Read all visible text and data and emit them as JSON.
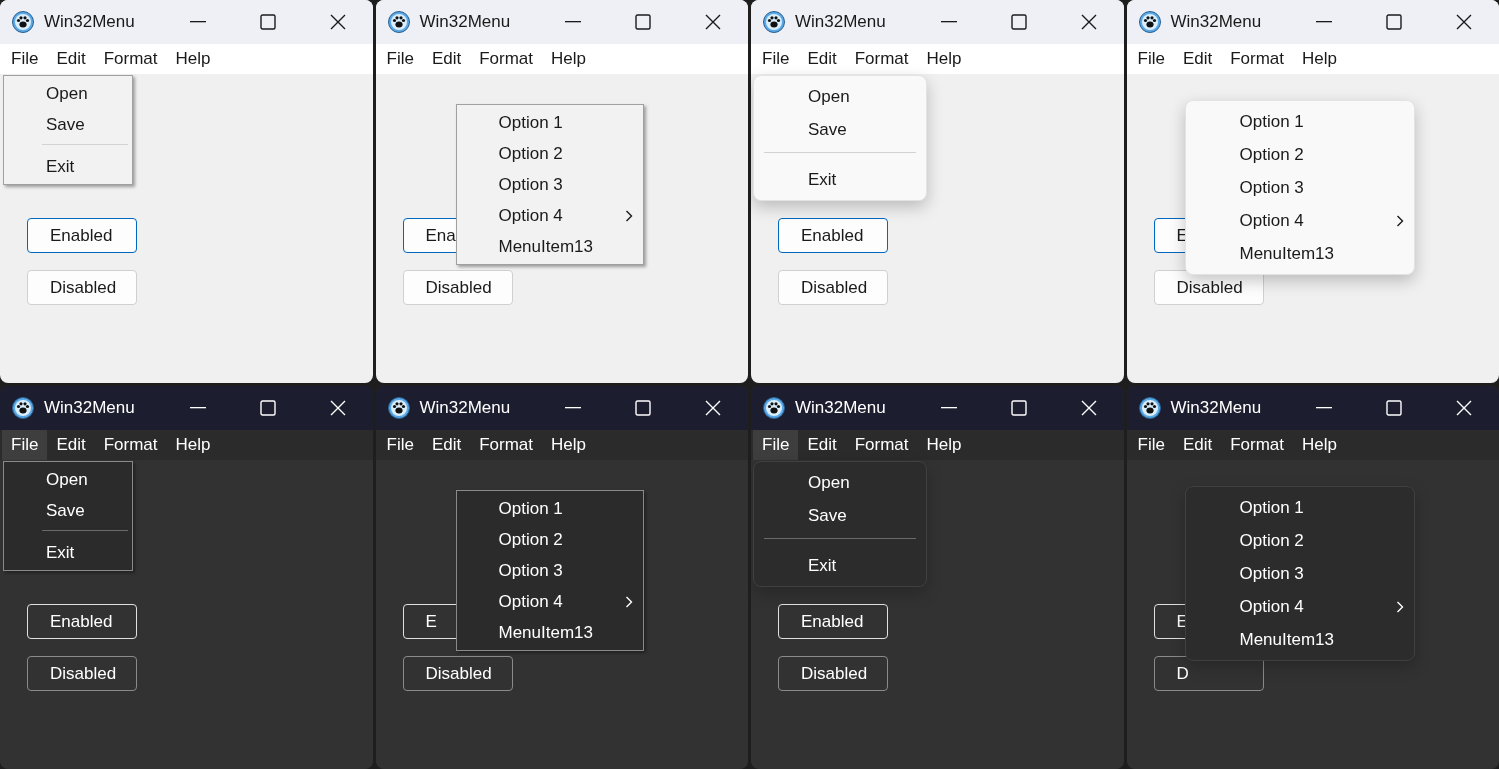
{
  "windows": [
    {
      "dark": false,
      "modern_menu": false,
      "title": "Win32Menu",
      "menu_bar": [
        {
          "label": "File",
          "selected": false
        },
        {
          "label": "Edit",
          "selected": false
        },
        {
          "label": "Format",
          "selected": false
        },
        {
          "label": "Help",
          "selected": false
        }
      ],
      "popup": {
        "kind": "dropdown",
        "items": [
          {
            "kind": "item",
            "label": "Open",
            "submenu": false
          },
          {
            "kind": "item",
            "label": "Save",
            "submenu": false
          },
          {
            "kind": "separator"
          },
          {
            "kind": "item",
            "label": "Exit",
            "submenu": false
          }
        ]
      },
      "buttons": [
        {
          "label": "Enabled",
          "focused": true
        },
        {
          "label": "Disabled",
          "focused": false
        }
      ]
    },
    {
      "dark": false,
      "modern_menu": false,
      "title": "Win32Menu",
      "menu_bar": [
        {
          "label": "File",
          "selected": false
        },
        {
          "label": "Edit",
          "selected": false
        },
        {
          "label": "Format",
          "selected": false
        },
        {
          "label": "Help",
          "selected": false
        }
      ],
      "popup": {
        "kind": "context",
        "items": [
          {
            "kind": "item",
            "label": "Option 1",
            "submenu": false
          },
          {
            "kind": "item",
            "label": "Option 2",
            "submenu": false
          },
          {
            "kind": "item",
            "label": "Option 3",
            "submenu": false
          },
          {
            "kind": "item",
            "label": "Option 4",
            "submenu": true
          },
          {
            "kind": "item",
            "label": "MenuItem13",
            "submenu": false
          }
        ]
      },
      "buttons": [
        {
          "label": "Ena",
          "focused": true
        },
        {
          "label": "Disabled",
          "focused": false
        }
      ]
    },
    {
      "dark": false,
      "modern_menu": true,
      "title": "Win32Menu",
      "menu_bar": [
        {
          "label": "File",
          "selected": false
        },
        {
          "label": "Edit",
          "selected": false
        },
        {
          "label": "Format",
          "selected": false
        },
        {
          "label": "Help",
          "selected": false
        }
      ],
      "popup": {
        "kind": "dropdown",
        "items": [
          {
            "kind": "item",
            "label": "Open",
            "submenu": false
          },
          {
            "kind": "item",
            "label": "Save",
            "submenu": false
          },
          {
            "kind": "separator"
          },
          {
            "kind": "item",
            "label": "Exit",
            "submenu": false
          }
        ]
      },
      "buttons": [
        {
          "label": "Enabled",
          "focused": true
        },
        {
          "label": "Disabled",
          "focused": false
        }
      ]
    },
    {
      "dark": false,
      "modern_menu": true,
      "title": "Win32Menu",
      "menu_bar": [
        {
          "label": "File",
          "selected": false
        },
        {
          "label": "Edit",
          "selected": false
        },
        {
          "label": "Format",
          "selected": false
        },
        {
          "label": "Help",
          "selected": false
        }
      ],
      "popup": {
        "kind": "context",
        "items": [
          {
            "kind": "item",
            "label": "Option 1",
            "submenu": false
          },
          {
            "kind": "item",
            "label": "Option 2",
            "submenu": false
          },
          {
            "kind": "item",
            "label": "Option 3",
            "submenu": false
          },
          {
            "kind": "item",
            "label": "Option 4",
            "submenu": true
          },
          {
            "kind": "item",
            "label": "MenuItem13",
            "submenu": false
          }
        ]
      },
      "buttons": [
        {
          "label": "E",
          "focused": true
        },
        {
          "label": "Disabled",
          "focused": false
        }
      ]
    },
    {
      "dark": true,
      "modern_menu": false,
      "title": "Win32Menu",
      "menu_bar": [
        {
          "label": "File",
          "selected": true
        },
        {
          "label": "Edit",
          "selected": false
        },
        {
          "label": "Format",
          "selected": false
        },
        {
          "label": "Help",
          "selected": false
        }
      ],
      "popup": {
        "kind": "dropdown",
        "items": [
          {
            "kind": "item",
            "label": "Open",
            "submenu": false
          },
          {
            "kind": "item",
            "label": "Save",
            "submenu": false
          },
          {
            "kind": "separator"
          },
          {
            "kind": "item",
            "label": "Exit",
            "submenu": false
          }
        ]
      },
      "buttons": [
        {
          "label": "Enabled",
          "focused": true
        },
        {
          "label": "Disabled",
          "focused": false
        }
      ]
    },
    {
      "dark": true,
      "modern_menu": false,
      "title": "Win32Menu",
      "menu_bar": [
        {
          "label": "File",
          "selected": false
        },
        {
          "label": "Edit",
          "selected": false
        },
        {
          "label": "Format",
          "selected": false
        },
        {
          "label": "Help",
          "selected": false
        }
      ],
      "popup": {
        "kind": "context",
        "items": [
          {
            "kind": "item",
            "label": "Option 1",
            "submenu": false
          },
          {
            "kind": "item",
            "label": "Option 2",
            "submenu": false
          },
          {
            "kind": "item",
            "label": "Option 3",
            "submenu": false
          },
          {
            "kind": "item",
            "label": "Option 4",
            "submenu": true
          },
          {
            "kind": "item",
            "label": "MenuItem13",
            "submenu": false
          }
        ]
      },
      "buttons": [
        {
          "label": "E",
          "focused": true
        },
        {
          "label": "Disabled",
          "focused": false
        }
      ]
    },
    {
      "dark": true,
      "modern_menu": true,
      "title": "Win32Menu",
      "menu_bar": [
        {
          "label": "File",
          "selected": true
        },
        {
          "label": "Edit",
          "selected": false
        },
        {
          "label": "Format",
          "selected": false
        },
        {
          "label": "Help",
          "selected": false
        }
      ],
      "popup": {
        "kind": "dropdown",
        "items": [
          {
            "kind": "item",
            "label": "Open",
            "submenu": false
          },
          {
            "kind": "item",
            "label": "Save",
            "submenu": false
          },
          {
            "kind": "separator"
          },
          {
            "kind": "item",
            "label": "Exit",
            "submenu": false
          }
        ]
      },
      "buttons": [
        {
          "label": "Enabled",
          "focused": true
        },
        {
          "label": "Disabled",
          "focused": false
        }
      ]
    },
    {
      "dark": true,
      "modern_menu": true,
      "title": "Win32Menu",
      "menu_bar": [
        {
          "label": "File",
          "selected": false
        },
        {
          "label": "Edit",
          "selected": false
        },
        {
          "label": "Format",
          "selected": false
        },
        {
          "label": "Help",
          "selected": false
        }
      ],
      "popup": {
        "kind": "context",
        "items": [
          {
            "kind": "item",
            "label": "Option 1",
            "submenu": false
          },
          {
            "kind": "item",
            "label": "Option 2",
            "submenu": false
          },
          {
            "kind": "item",
            "label": "Option 3",
            "submenu": false
          },
          {
            "kind": "item",
            "label": "Option 4",
            "submenu": true
          },
          {
            "kind": "item",
            "label": "MenuItem13",
            "submenu": false
          }
        ]
      },
      "buttons": [
        {
          "label": "E",
          "focused": true
        },
        {
          "label": "D",
          "focused": false
        }
      ]
    }
  ]
}
